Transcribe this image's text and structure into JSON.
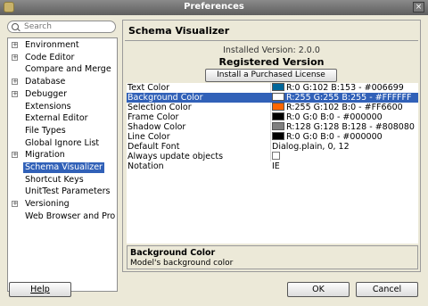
{
  "window": {
    "title": "Preferences",
    "close_glyph": "×"
  },
  "search": {
    "placeholder": "Search"
  },
  "nav": {
    "items": [
      {
        "label": "Environment",
        "expandable": true,
        "selected": false
      },
      {
        "label": "Code Editor",
        "expandable": true,
        "selected": false
      },
      {
        "label": "Compare and Merge",
        "expandable": false,
        "selected": false
      },
      {
        "label": "Database",
        "expandable": true,
        "selected": false
      },
      {
        "label": "Debugger",
        "expandable": true,
        "selected": false
      },
      {
        "label": "Extensions",
        "expandable": false,
        "selected": false
      },
      {
        "label": "External Editor",
        "expandable": false,
        "selected": false
      },
      {
        "label": "File Types",
        "expandable": false,
        "selected": false
      },
      {
        "label": "Global Ignore List",
        "expandable": false,
        "selected": false
      },
      {
        "label": "Migration",
        "expandable": true,
        "selected": false
      },
      {
        "label": "Schema Visualizer",
        "expandable": false,
        "selected": true
      },
      {
        "label": "Shortcut Keys",
        "expandable": false,
        "selected": false
      },
      {
        "label": "UnitTest Parameters",
        "expandable": false,
        "selected": false
      },
      {
        "label": "Versioning",
        "expandable": true,
        "selected": false
      },
      {
        "label": "Web Browser and Pro",
        "expandable": false,
        "selected": false
      }
    ]
  },
  "page": {
    "title": "Schema Visualizer",
    "installed_version": "Installed Version: 2.0.0",
    "registered": "Registered Version",
    "license_button": "Install a Purchased License"
  },
  "properties": [
    {
      "name": "Text Color",
      "value": "R:0 G:102 B:153 - #006699",
      "swatch": "#006699",
      "selected": false
    },
    {
      "name": "Background Color",
      "value": "R:255 G:255 B:255 - #FFFFFF",
      "swatch": "#FFFFFF",
      "selected": true
    },
    {
      "name": "Selection Color",
      "value": "R:255 G:102 B:0 - #FF6600",
      "swatch": "#FF6600",
      "selected": false
    },
    {
      "name": "Frame Color",
      "value": "R:0 G:0 B:0 - #000000",
      "swatch": "#000000",
      "selected": false
    },
    {
      "name": "Shadow Color",
      "value": "R:128 G:128 B:128 - #808080",
      "swatch": "#808080",
      "selected": false
    },
    {
      "name": "Line Color",
      "value": "R:0 G:0 B:0 - #000000",
      "swatch": "#000000",
      "selected": false
    },
    {
      "name": "Default Font",
      "value": "Dialog.plain, 0, 12",
      "swatch": null,
      "selected": false
    },
    {
      "name": "Always update objects",
      "value": "",
      "checkbox": true,
      "checked": false,
      "selected": false
    },
    {
      "name": "Notation",
      "value": "IE",
      "swatch": null,
      "selected": false
    }
  ],
  "description": {
    "title": "Background Color",
    "text": "Model's background color"
  },
  "buttons": {
    "help": "Help",
    "ok": "OK",
    "cancel": "Cancel"
  },
  "colors": {
    "selection": "#3161B8",
    "dialog_bg": "#ECE9D8"
  }
}
